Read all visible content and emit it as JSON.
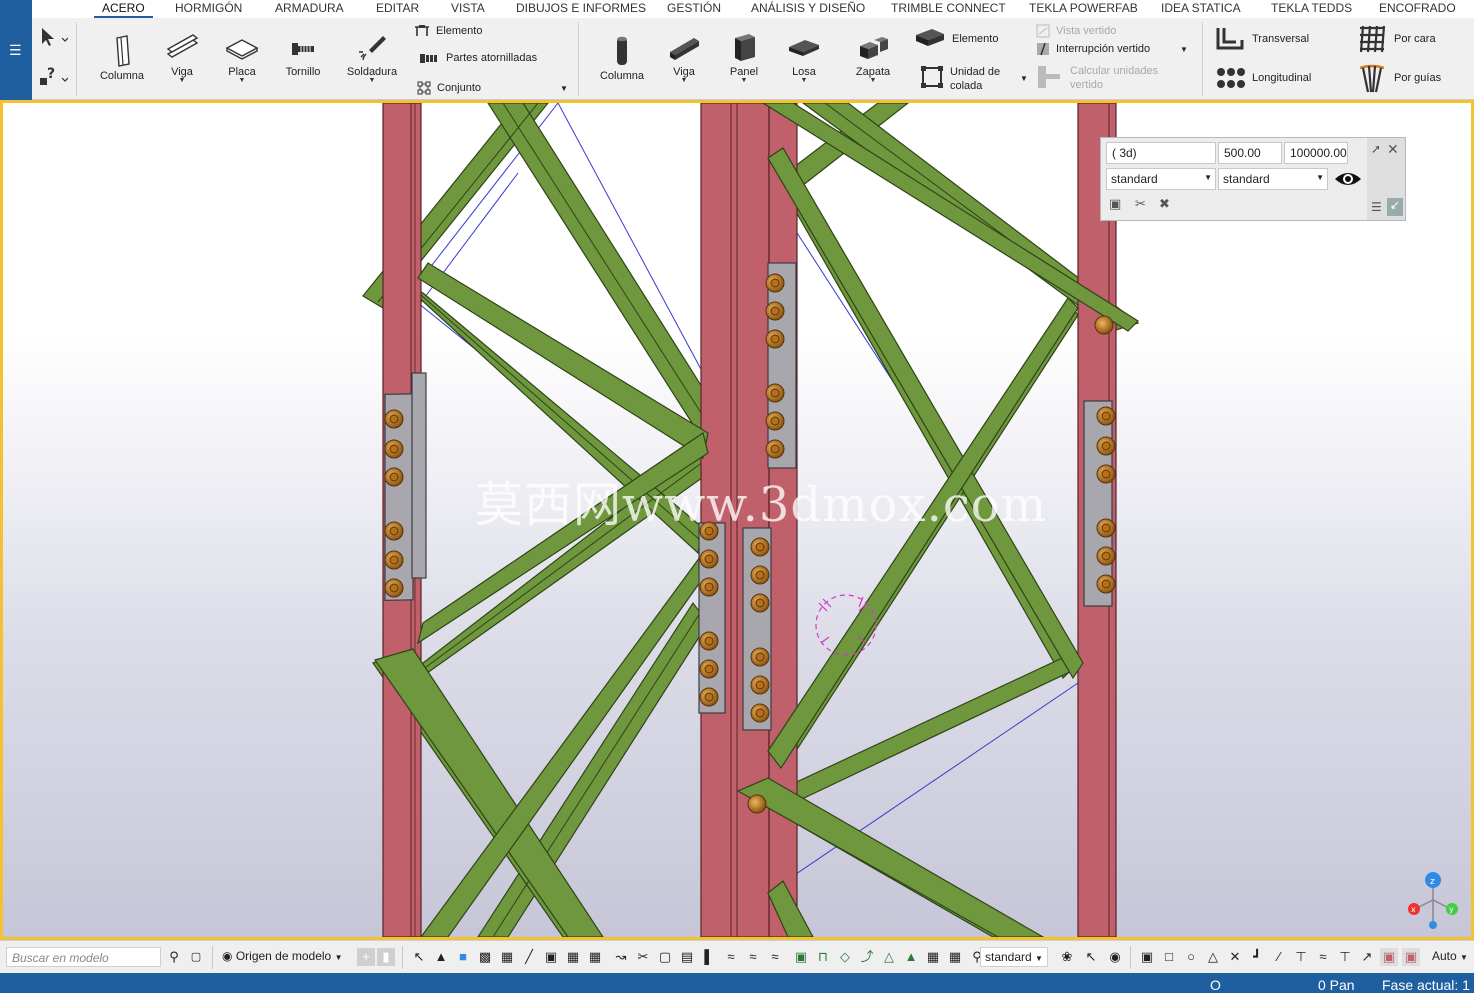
{
  "menu": {
    "tabs": [
      "ACERO",
      "HORMIGÓN",
      "ARMADURA",
      "EDITAR",
      "VISTA",
      "DIBUJOS E INFORMES",
      "GESTIÓN",
      "ANÁLISIS Y DISEÑO",
      "TRIMBLE CONNECT",
      "TEKLA POWERFAB",
      "IDEA STATICA",
      "TEKLA TEDDS",
      "ENCOFRADO"
    ],
    "active": "ACERO"
  },
  "ribbon": {
    "steel": {
      "columna": "Columna",
      "viga": "Viga",
      "placa": "Placa",
      "tornillo": "Tornillo",
      "soldadura": "Soldadura",
      "elemento": "Elemento",
      "partes_atornilladas": "Partes atornilladas",
      "conjunto": "Conjunto"
    },
    "concrete": {
      "columna": "Columna",
      "viga": "Viga",
      "panel": "Panel",
      "losa": "Losa",
      "zapata": "Zapata",
      "elemento": "Elemento",
      "unidad_de_colada_1": "Unidad de",
      "unidad_de_colada_2": "colada",
      "vista_vertido": "Vista vertido",
      "interrupcion_vertido": "Interrupción vertido",
      "calcular_unidades_1": "Calcular unidades",
      "calcular_unidades_2": "vertido"
    },
    "rebar": {
      "transversal": "Transversal",
      "longitudinal": "Longitudinal",
      "por_cara": "Por cara",
      "por_guias": "Por guías"
    }
  },
  "view_panel": {
    "view_name": "( 3d)",
    "depth": "500.00",
    "distance": "100000.00",
    "filter_1": "standard",
    "filter_2": "standard"
  },
  "watermark": "莫西网www.3dmox.com",
  "bottom": {
    "search_placeholder": "Buscar en modelo",
    "origin": "Origen de modelo",
    "selection_filter": "standard",
    "snap_mode": "Auto"
  },
  "status": {
    "o_label": "O",
    "pan": "0 Pan",
    "fase": "Fase actual: 1"
  },
  "colors": {
    "column": "#c0606a",
    "brace": "#6e973e",
    "plate": "#a7a7ad",
    "bolt": "#d08a2a",
    "accent": "#1f5fa0",
    "viewport_border": "#f2c233"
  }
}
